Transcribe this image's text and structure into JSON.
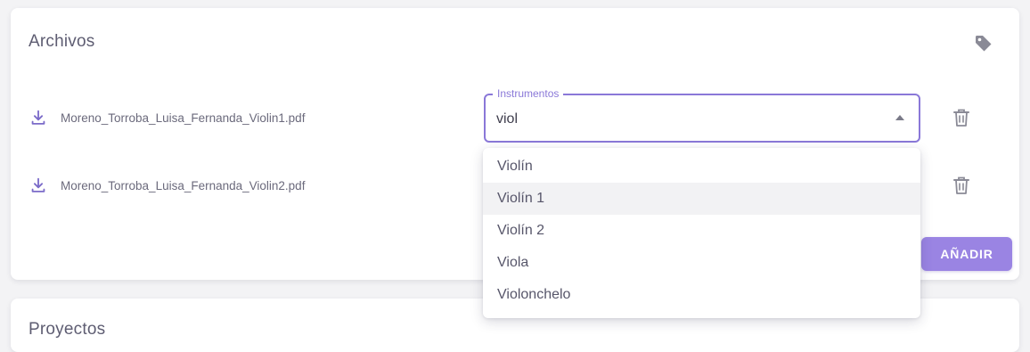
{
  "files_card": {
    "title": "Archivos",
    "files": [
      {
        "name": "Moreno_Torroba_Luisa_Fernanda_Violin1.pdf"
      },
      {
        "name": "Moreno_Torroba_Luisa_Fernanda_Violin2.pdf"
      }
    ],
    "instrument_field": {
      "label": "Instrumentos",
      "value": "viol"
    },
    "dropdown_options": [
      "Violín",
      "Violín 1",
      "Violín 2",
      "Viola",
      "Violonchelo"
    ],
    "highlighted_option": "Violín 1",
    "add_button_label": "AÑADIR"
  },
  "projects_card": {
    "title": "Proyectos"
  },
  "colors": {
    "accent": "#8a78d8",
    "button": "#9a84e3",
    "icon": "#7b6bc9",
    "muted_icon": "#8a8a96"
  }
}
